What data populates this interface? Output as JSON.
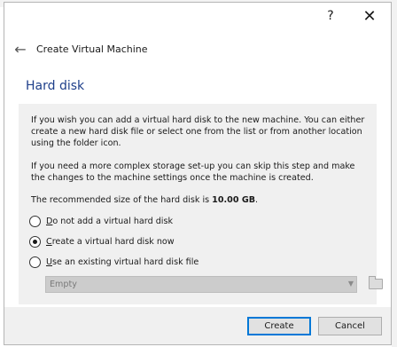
{
  "window": {
    "help_glyph": "?",
    "close_glyph": "✕"
  },
  "header": {
    "back_glyph": "←",
    "title": "Create Virtual Machine"
  },
  "page": {
    "title": "Hard disk",
    "paragraph1": "If you wish you can add a virtual hard disk to the new machine. You can either create a new hard disk file or select one from the list or from another location using the folder icon.",
    "paragraph2": "If you need a more complex storage set-up you can skip this step and make the changes to the machine settings once the machine is created.",
    "recommended_prefix": "The recommended size of the hard disk is ",
    "recommended_size": "10.00 GB",
    "recommended_suffix": "."
  },
  "options": {
    "no_disk": {
      "mnemonic": "D",
      "rest": "o not add a virtual hard disk",
      "checked": false
    },
    "create_disk": {
      "mnemonic": "C",
      "rest": "reate a virtual hard disk now",
      "checked": true
    },
    "existing_disk": {
      "mnemonic": "U",
      "rest": "se an existing virtual hard disk file",
      "checked": false
    }
  },
  "disk_select": {
    "value": "Empty",
    "arrow_glyph": "▼",
    "enabled": false
  },
  "icons": {
    "back": "arrow-left-icon",
    "help": "help-icon",
    "close": "close-icon",
    "folder": "folder-icon",
    "dropdown": "chevron-down-icon"
  },
  "footer": {
    "create_label": "Create",
    "cancel_label": "Cancel"
  },
  "colors": {
    "title_blue": "#1e3f8a",
    "focus_blue": "#0078d7"
  }
}
